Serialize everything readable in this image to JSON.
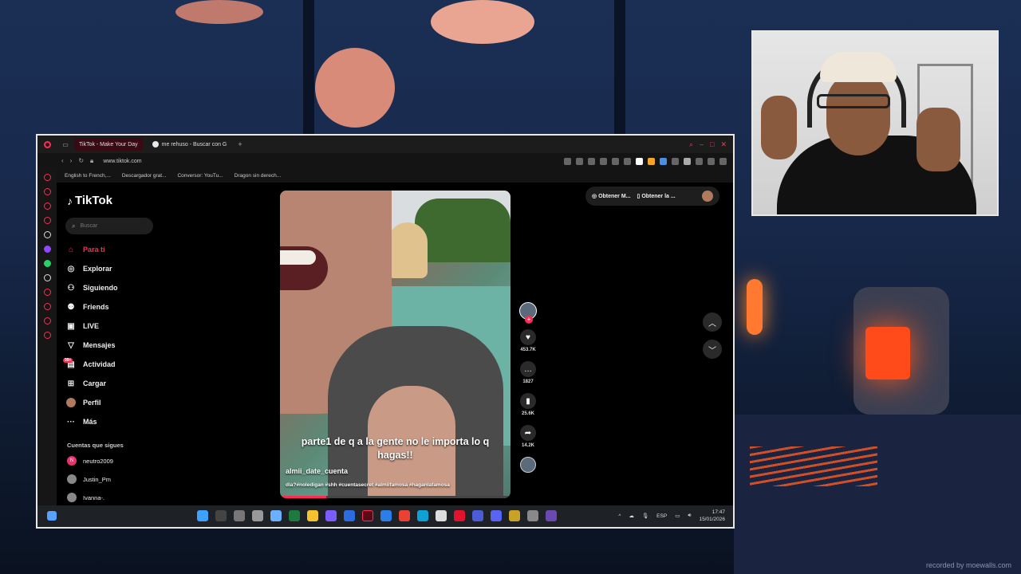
{
  "browser": {
    "tabs": [
      {
        "label": "TikTok - Make Your Day",
        "active": true
      },
      {
        "label": "me rehuso - Buscar con G",
        "active": false
      }
    ],
    "new_tab": "+",
    "url": "www.tiktok.com",
    "bookmarks": [
      "English to French,...",
      "Descargador grat...",
      "Conversor: YouTu...",
      "Dragon sin derech..."
    ]
  },
  "tiktok": {
    "logo": "TikTok",
    "search_placeholder": "Buscar",
    "menu": [
      {
        "label": "Para ti",
        "icon": "home-icon",
        "active": true
      },
      {
        "label": "Explorar",
        "icon": "compass-icon"
      },
      {
        "label": "Siguiendo",
        "icon": "following-icon"
      },
      {
        "label": "Friends",
        "icon": "friends-icon"
      },
      {
        "label": "LIVE",
        "icon": "live-icon"
      },
      {
        "label": "Mensajes",
        "icon": "messages-icon"
      },
      {
        "label": "Actividad",
        "icon": "activity-icon",
        "badge": "99+"
      },
      {
        "label": "Cargar",
        "icon": "upload-icon"
      },
      {
        "label": "Perfil",
        "icon": "profile-icon"
      },
      {
        "label": "Más",
        "icon": "more-icon"
      }
    ],
    "following_title": "Cuentas que sigues",
    "following": [
      "neutro2009",
      "Justin_Pm",
      "Ivanna-."
    ],
    "video": {
      "caption": "parte1 de q a la gente no le importa lo q hagas!!",
      "author": "almii_date_cuenta",
      "hashtags": "dia?#noledigan #shh #cuentasecret #almiifamosa #haganlafamosa",
      "progress": 0.2
    },
    "actions": {
      "likes": "453.7K",
      "comments": "1827",
      "saves": "25.6K",
      "shares": "14.2K"
    },
    "get_app": [
      "Obtener M...",
      "Obtener la ..."
    ]
  },
  "taskbar": {
    "lang": "ESP",
    "time": "17:47",
    "date": "15/01/2026"
  },
  "watermark": "recorded by moewalls.com"
}
